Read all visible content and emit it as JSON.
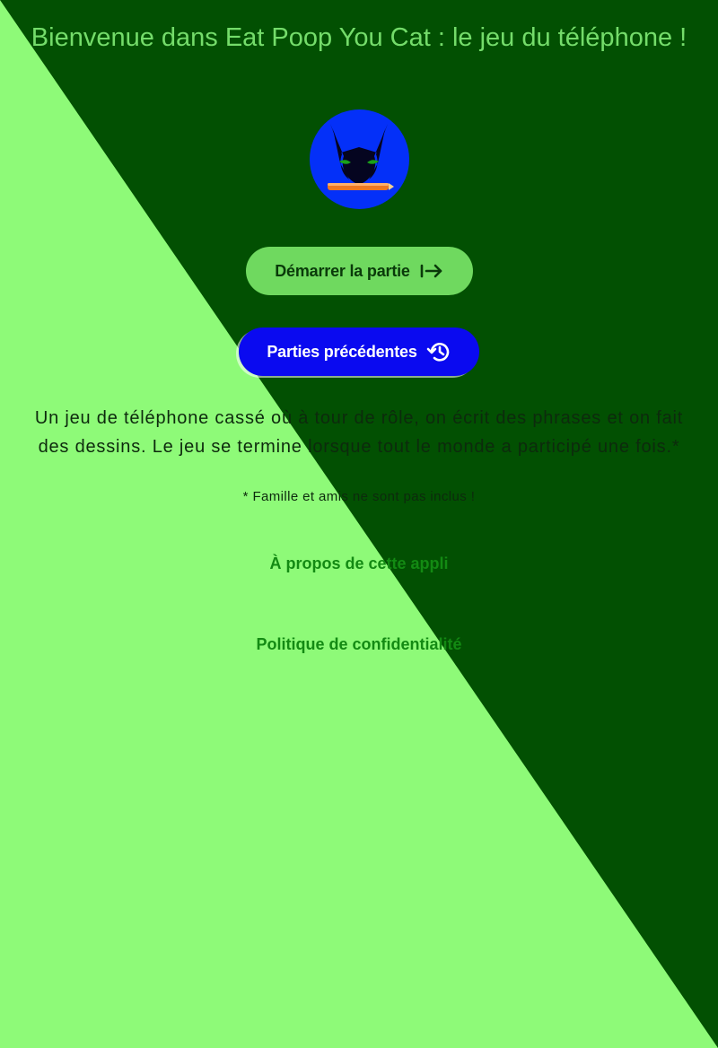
{
  "header": {
    "title": "Bienvenue dans Eat Poop You Cat : le jeu du téléphone !"
  },
  "logo": {
    "icon": "cat-with-pencil-icon",
    "background_color": "#0430f8"
  },
  "actions": {
    "start_label": "Démarrer la partie",
    "start_icon": "arrow-right-to-bar-icon",
    "history_label": "Parties précédentes",
    "history_icon": "history-icon"
  },
  "description": {
    "line1": "Un jeu de téléphone cassé où à tour de rôle, on écrit des phrases et on fait",
    "line2": "des dessins. Le jeu se termine lorsque tout le monde a participé une fois.*"
  },
  "footnote": "* Famille et amis ne sont pas inclus !",
  "links": {
    "about": "À propos de cette appli",
    "privacy": "Politique de confidentialité"
  },
  "colors": {
    "background_light": "#8efa78",
    "background_dark": "#025002",
    "title": "#74dc6a",
    "start_button": "#6fd95f",
    "history_button": "#0a0af0",
    "links": "#138a13"
  }
}
